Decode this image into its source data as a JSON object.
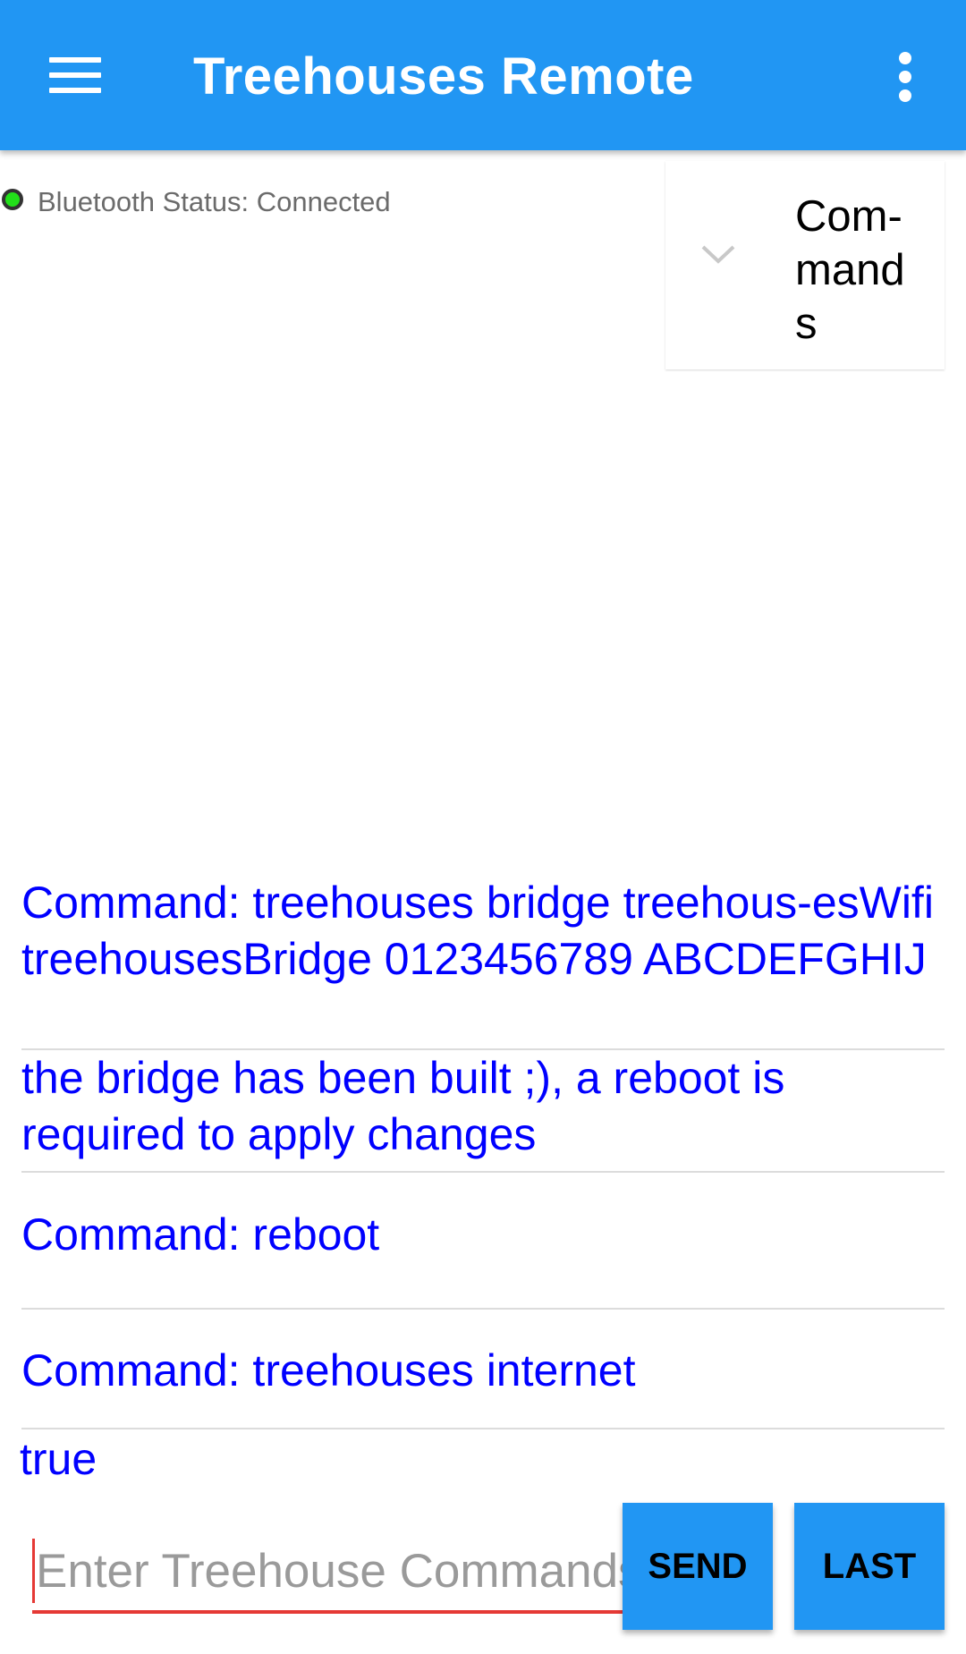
{
  "appbar": {
    "title": "Treehouses Remote",
    "menu_icon": "hamburger-menu-icon",
    "overflow_icon": "more-vert-icon",
    "color": "#2196F3"
  },
  "status": {
    "label": "Bluetooth Status: Connected",
    "dot_color": "#22e01a"
  },
  "spinner": {
    "selected": "Com-\nmand\ns",
    "arrow_icon": "chevron-down-icon"
  },
  "console": {
    "text_color": "#0000FF",
    "rows": [
      "Command:  treehouses bridge treehous-esWifi treehousesBridge 0123456789 ABCDEFGHIJ",
      "the bridge has been built ;), a reboot is required to apply changes",
      "Command:  reboot",
      "Command:  treehouses internet",
      "true"
    ]
  },
  "input": {
    "placeholder": "Enter Treehouse Commands",
    "value": ""
  },
  "buttons": {
    "send": "SEND",
    "last": "LAST"
  }
}
